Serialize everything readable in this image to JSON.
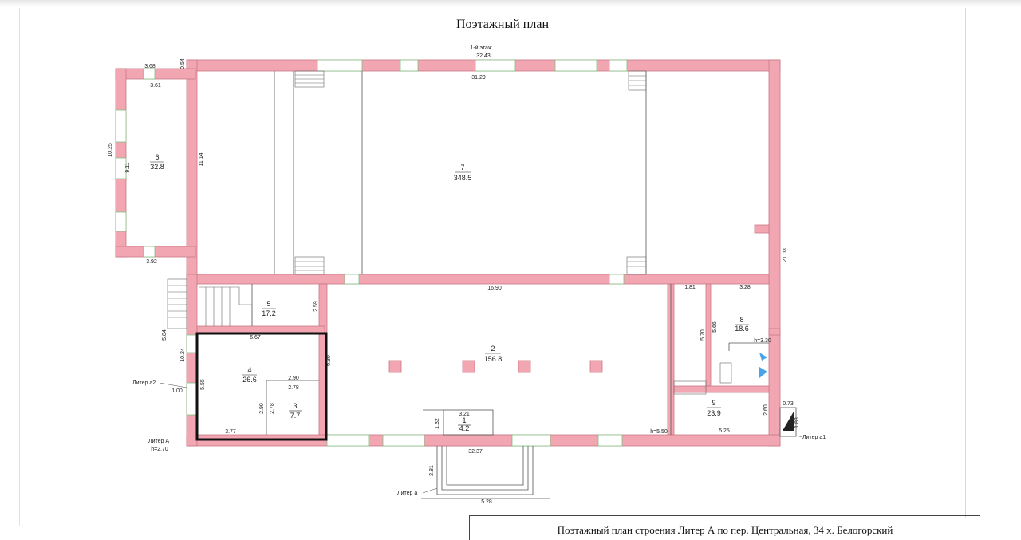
{
  "header": {
    "title": "Поэтажный план"
  },
  "footer": {
    "text": "Поэтажный план строения Литер А по пер. Центральная, 34  х. Белогорский"
  },
  "plan": {
    "floor_label": "1-й этаж",
    "rooms": [
      {
        "number": "1",
        "area": "4.2"
      },
      {
        "number": "2",
        "area": "156.8"
      },
      {
        "number": "3",
        "area": "7.7"
      },
      {
        "number": "4",
        "area": "26.6"
      },
      {
        "number": "5",
        "area": "17.2"
      },
      {
        "number": "6",
        "area": "32.8"
      },
      {
        "number": "7",
        "area": "348.5"
      },
      {
        "number": "8",
        "area": "18.6"
      },
      {
        "number": "9",
        "area": "23.9"
      }
    ],
    "dimensions": {
      "d_32_43": "32.43",
      "d_31_29": "31.29",
      "d_3_68": "3.68",
      "d_0_54": "0.54",
      "d_3_61": "3.61",
      "d_10_25": "10.25",
      "d_9_11": "9.11",
      "d_11_14": "11.14",
      "d_3_92": "3.92",
      "d_21_03": "21.03",
      "d_16_90": "16.90",
      "d_1_81": "1.81",
      "d_3_28": "3.28",
      "d_5_70": "5.70",
      "d_5_66": "5.66",
      "d_2_59": "2.59",
      "d_6_67": "6.67",
      "d_5_84": "5.84",
      "d_10_24": "10.24",
      "d_5_55": "5.55",
      "d_6_30": "6.30",
      "d_2_90a": "2.90",
      "d_2_78a": "2.78",
      "d_2_90b": "2.90",
      "d_2_78b": "2.78",
      "d_3_77": "3.77",
      "d_1_00": "1.00",
      "d_3_21": "3.21",
      "d_1_32": "1.32",
      "d_32_37": "32.37",
      "d_2_81": "2.81",
      "d_5_28": "5.28",
      "d_2_60": "2.60",
      "d_5_25": "5.25",
      "d_0_73": "0.73",
      "d_1_83": "1.83"
    },
    "heights": {
      "h1": "h=2.70",
      "h2": "h=5.50",
      "h3": "h=3.30"
    },
    "liters": {
      "a_main": "Литер А",
      "a2": "Литер а2",
      "a_front": "Литер а",
      "a1": "Литер а1"
    }
  }
}
